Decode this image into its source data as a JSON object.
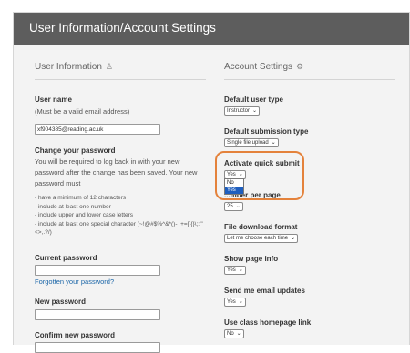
{
  "header": {
    "title": "User Information/Account Settings"
  },
  "user_info": {
    "title": "User Information",
    "icon": "user-icon",
    "user_name_label": "User name",
    "user_name_hint": "(Must be a valid email address)",
    "user_name_value": "xf904385@reading.ac.uk",
    "change_password_title": "Change your password",
    "change_password_text": "You will be required to log back in with your new password after the change has been saved. Your new password must",
    "requirements": [
      "- have a minimum of 12 characters",
      "- include at least one number",
      "- include upper and lower case letters",
      "- include at least one special character (~!@#$%^&*()-_+=[]{}\\;:'\"<>,.?/)"
    ],
    "current_password_label": "Current password",
    "forgotten_link": "Forgotten your password?",
    "new_password_label": "New password",
    "confirm_password_label": "Confirm new password"
  },
  "account_settings": {
    "title": "Account Settings",
    "icon": "gear-icon",
    "default_user_type": {
      "label": "Default user type",
      "value": "Instructor"
    },
    "default_submission_type": {
      "label": "Default submission type",
      "value": "Single file upload"
    },
    "activate_quick_submit": {
      "label": "Activate quick submit",
      "value": "Yes",
      "options": [
        "No",
        "Yes"
      ],
      "selected_option": "Yes"
    },
    "items_per_page": {
      "label": "...mber per page",
      "value": "25"
    },
    "file_download_format": {
      "label": "File download format",
      "value": "Let me choose each time"
    },
    "show_page_info": {
      "label": "Show page info",
      "value": "Yes"
    },
    "send_email_updates": {
      "label": "Send me email updates",
      "value": "Yes"
    },
    "use_class_homepage_link": {
      "label": "Use class homepage link",
      "value": "No"
    }
  },
  "colors": {
    "header_bg": "#5d5d5d",
    "highlight": "#e4823b",
    "link": "#1b66a8",
    "selected_option": "#1f5fbf"
  }
}
